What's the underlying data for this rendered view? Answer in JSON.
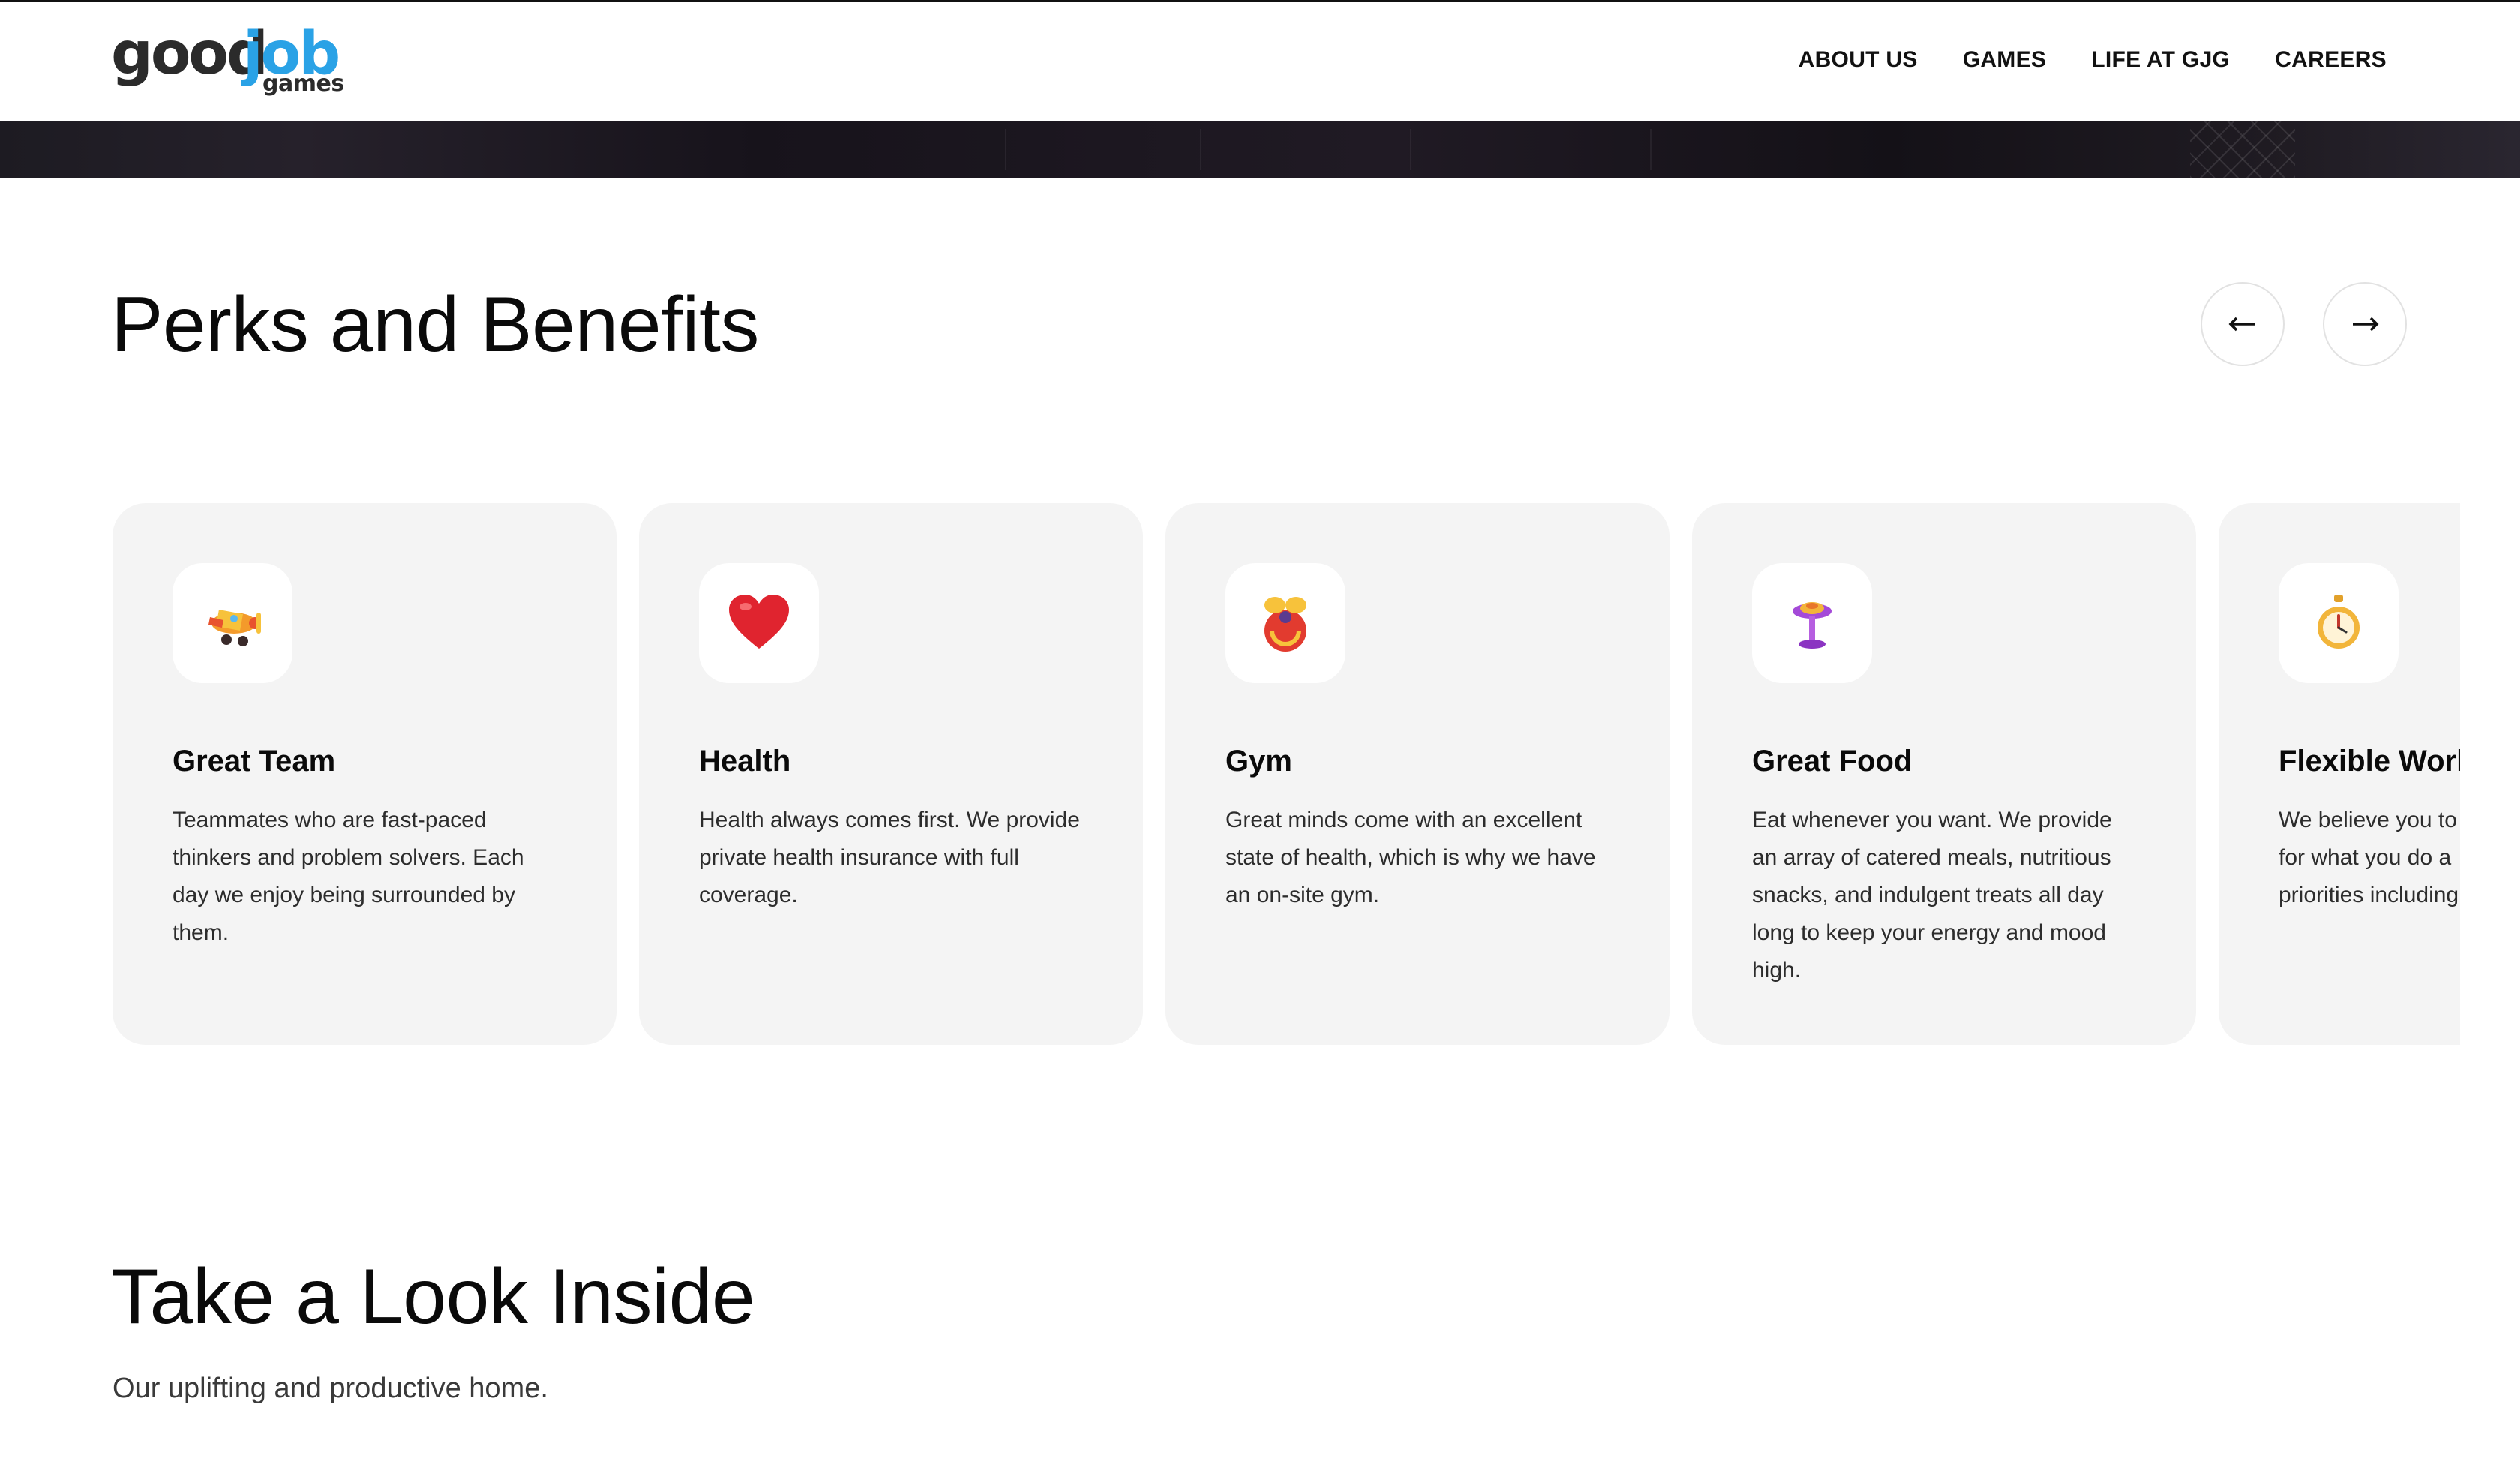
{
  "brand": {
    "logo_good": "good",
    "logo_job": "job",
    "logo_games": "games",
    "colors": {
      "dark": "#2b2b2b",
      "blue": "#2aa2e6"
    }
  },
  "nav": {
    "items": [
      {
        "label": "ABOUT US"
      },
      {
        "label": "GAMES"
      },
      {
        "label": "LIFE AT GJG"
      },
      {
        "label": "CAREERS"
      }
    ]
  },
  "perks": {
    "title": "Perks and Benefits",
    "prev_icon": "arrow-left-icon",
    "next_icon": "arrow-right-icon",
    "cards": [
      {
        "icon": "toy-airplane-icon",
        "title": "Great Team",
        "text": "Teammates who are fast-paced thinkers and problem solvers. Each day we enjoy being surrounded by them."
      },
      {
        "icon": "heart-icon",
        "title": "Health",
        "text": "Health always comes first. We provide private health insurance with full coverage."
      },
      {
        "icon": "kettlebell-icon",
        "title": "Gym",
        "text": "Great minds come with an excellent state of health, which is why we have an on-site gym."
      },
      {
        "icon": "cake-stand-icon",
        "title": "Great Food",
        "text": "Eat whenever you want. We provide an array of catered meals, nutritious snacks, and indulgent treats all day long to keep your energy and mood high."
      },
      {
        "icon": "stopwatch-icon",
        "title": "Flexible Work",
        "text": "We believe you to for what you do a priorities including"
      }
    ]
  },
  "look": {
    "title": "Take a Look Inside",
    "subtitle": "Our uplifting and productive home."
  }
}
